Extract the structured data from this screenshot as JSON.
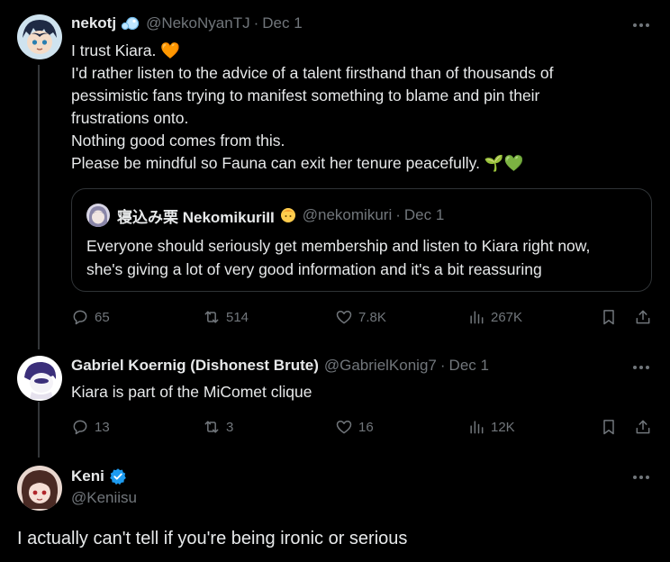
{
  "tweet1": {
    "name": "nekotj",
    "handle": "@NekoNyanTJ",
    "date": "Dec 1",
    "lines": [
      "I trust Kiara. 🧡",
      "I'd rather listen to the advice of a talent firsthand than of thousands of",
      "pessimistic fans trying to manifest something to blame and pin their",
      "frustrations onto.",
      "Nothing good comes from this.",
      "Please be mindful so Fauna can exit her tenure peacefully. 🌱💚"
    ],
    "quote": {
      "name": "寝込み栗 NekomikuriII",
      "handle": "@nekomikuri",
      "date": "Dec 1",
      "lines": [
        "Everyone should seriously get membership and listen to Kiara right now,",
        "she's giving a lot of very good information and it's a bit reassuring"
      ]
    },
    "stats": {
      "replies": "65",
      "reposts": "514",
      "likes": "7.8K",
      "views": "267K"
    }
  },
  "tweet2": {
    "name": "Gabriel Koernig (Dishonest Brute)",
    "handle": "@GabrielKonig7",
    "date": "Dec 1",
    "text": "Kiara is part of the MiComet clique",
    "stats": {
      "replies": "13",
      "reposts": "3",
      "likes": "16",
      "views": "12K"
    }
  },
  "tweet3": {
    "name": "Keni",
    "handle": "@Keniisu",
    "text": "I actually can't tell if you're being ironic or serious"
  },
  "separator": "·",
  "colors": {
    "background": "#000000",
    "text": "#e7e9ea",
    "muted": "#71767b",
    "verified": "#1d9bf0"
  }
}
